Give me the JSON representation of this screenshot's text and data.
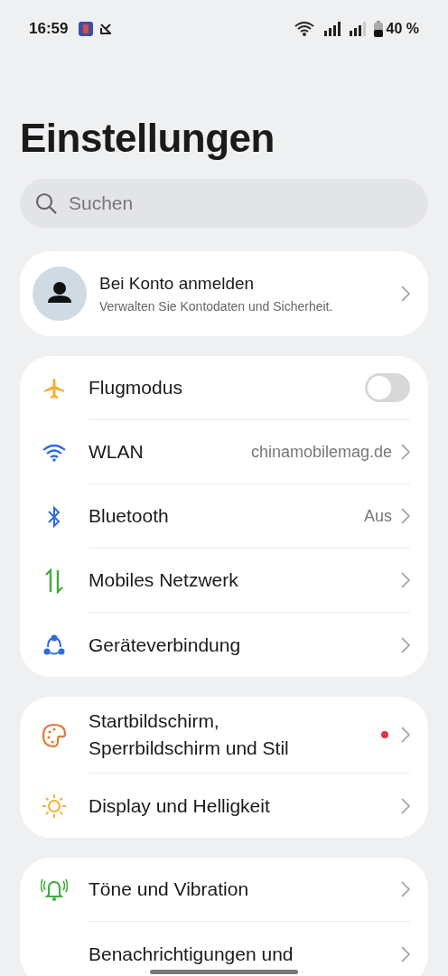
{
  "status_bar": {
    "time": "16:59",
    "battery": "40 %"
  },
  "title": "Einstellungen",
  "search": {
    "placeholder": "Suchen"
  },
  "account": {
    "title": "Bei Konto anmelden",
    "subtitle": "Verwalten Sie Kontodaten und Sicherheit."
  },
  "groups": [
    {
      "items": [
        {
          "kind": "toggle",
          "label": "Flugmodus",
          "on": false
        },
        {
          "kind": "link",
          "label": "WLAN",
          "value": "chinamobilemag.de"
        },
        {
          "kind": "link",
          "label": "Bluetooth",
          "value": "Aus"
        },
        {
          "kind": "link",
          "label": "Mobiles Netzwerk"
        },
        {
          "kind": "link",
          "label": "Geräteverbindung"
        }
      ]
    },
    {
      "items": [
        {
          "kind": "link",
          "label": "Startbildschirm, Sperrbildschirm und Stil",
          "color": "#e0343e"
        },
        {
          "kind": "link",
          "label": "Display und Helligkeit"
        }
      ]
    },
    {
      "items": [
        {
          "kind": "link",
          "label": "Töne und Vibration"
        },
        {
          "kind": "link",
          "label": "Benachrichtigungen und"
        }
      ]
    }
  ]
}
